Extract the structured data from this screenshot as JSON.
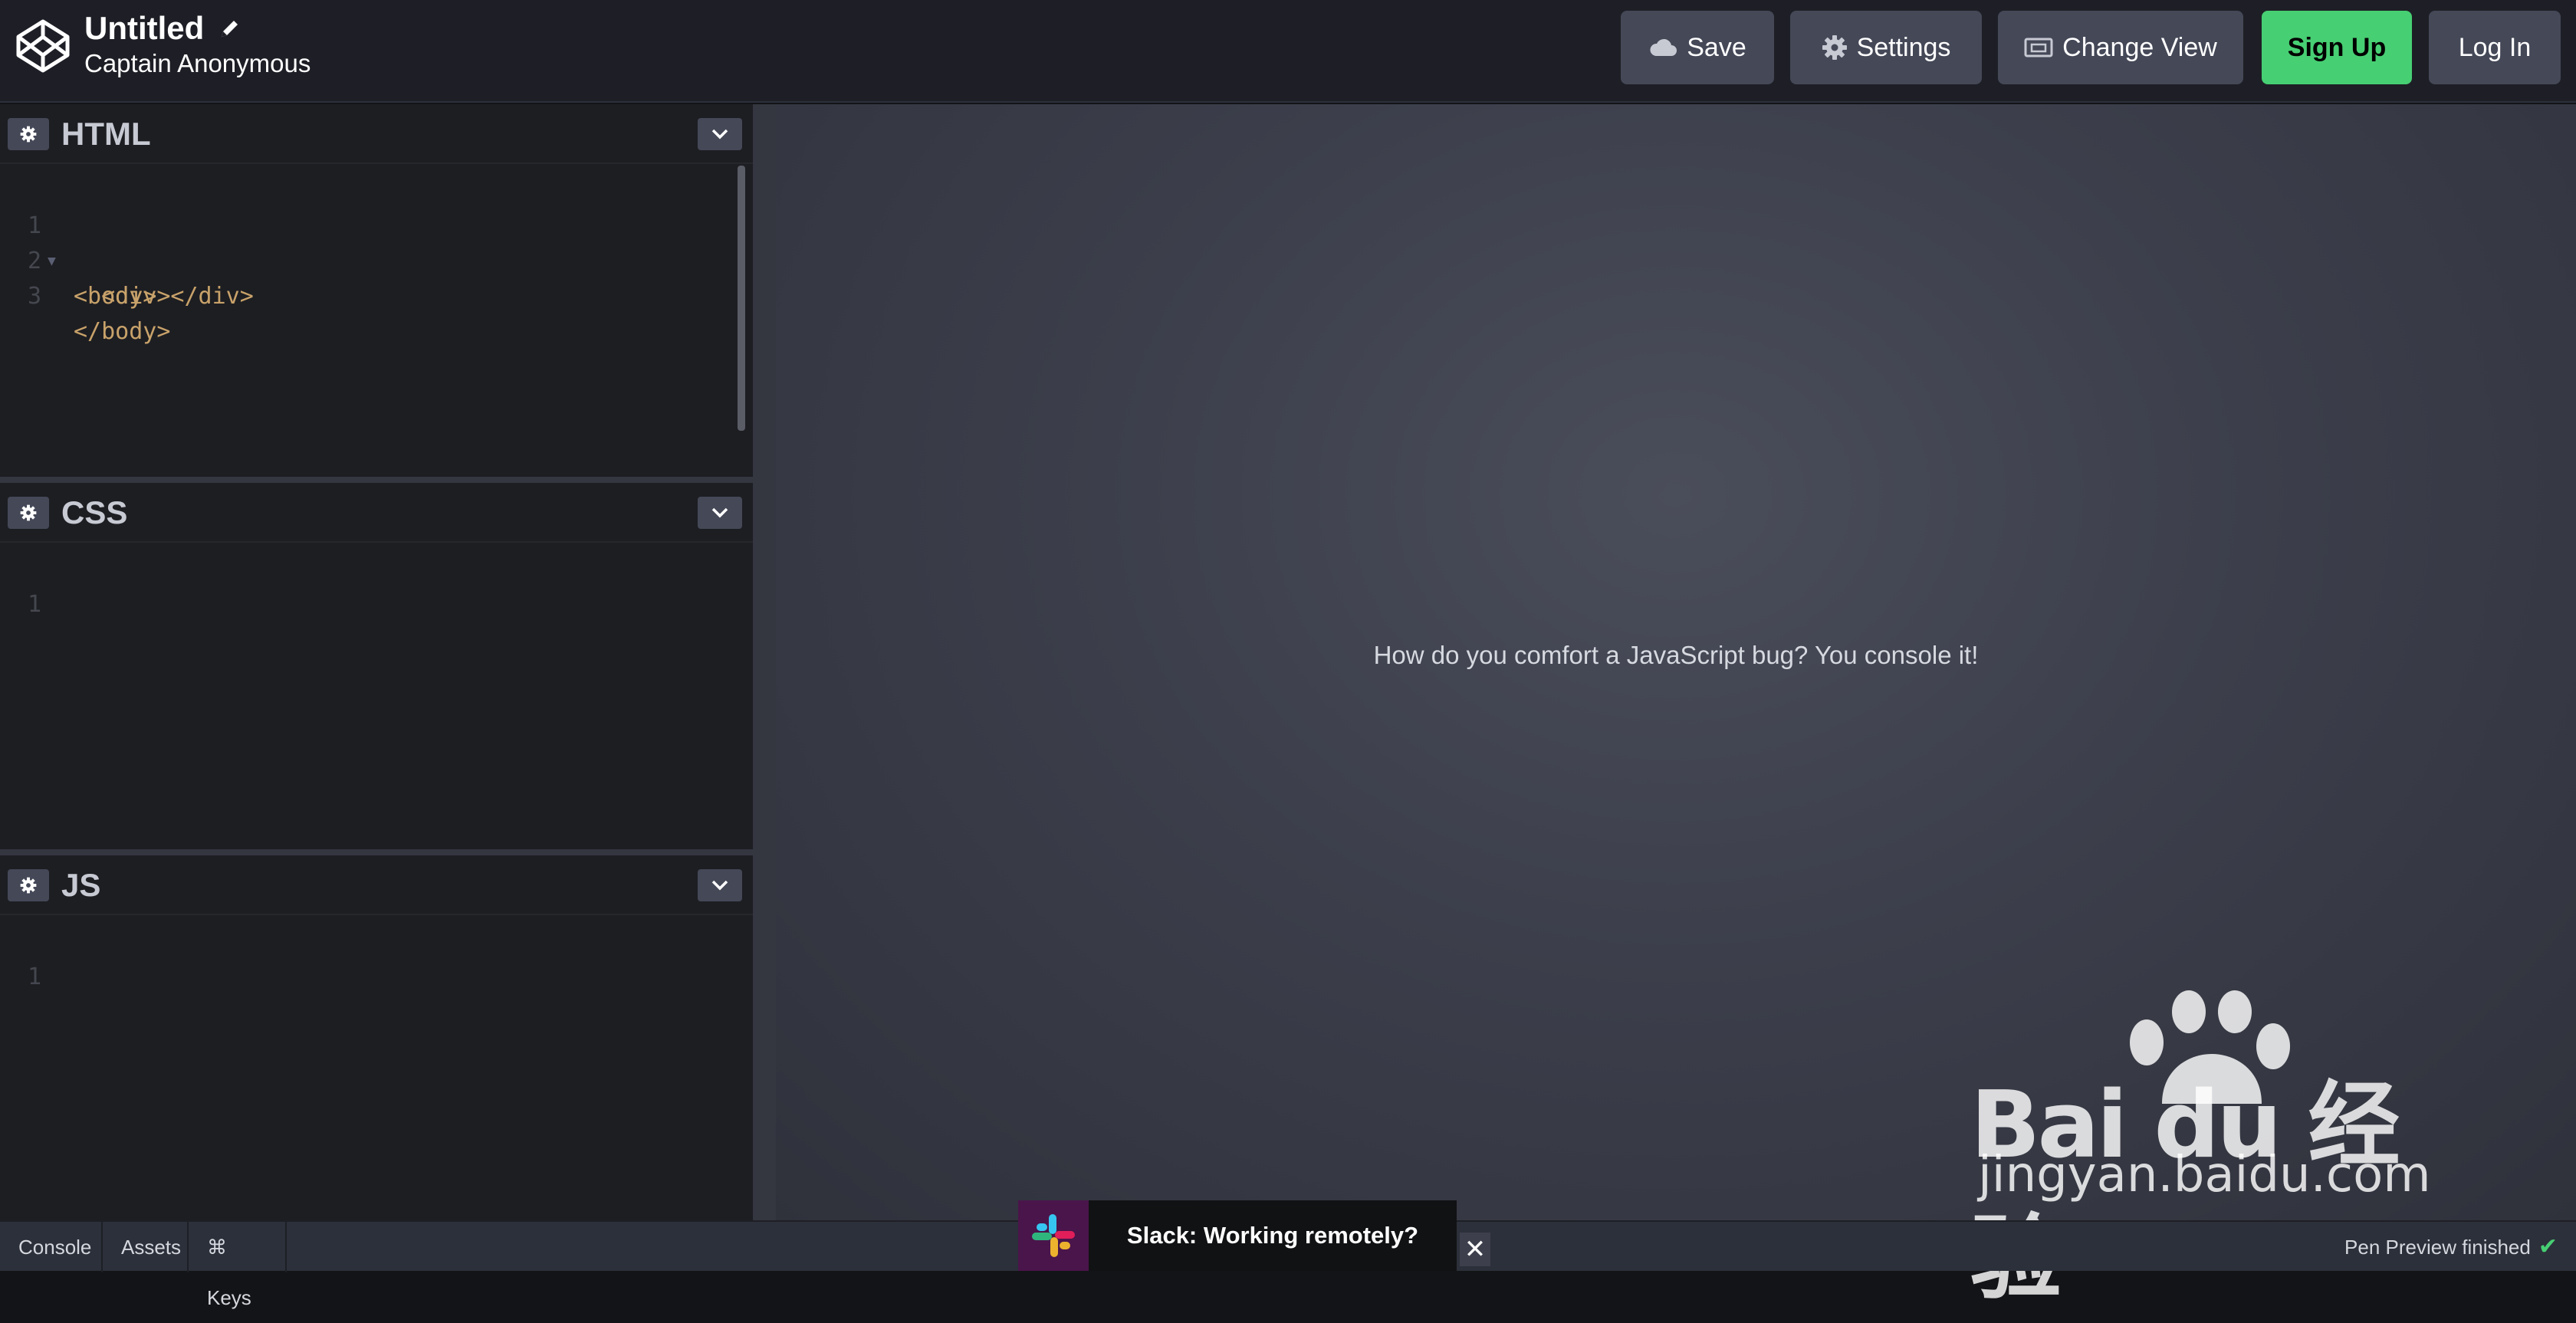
{
  "header": {
    "title": "Untitled",
    "author": "Captain Anonymous",
    "buttons": {
      "save": "Save",
      "settings": "Settings",
      "change_view": "Change View",
      "sign_up": "Sign Up",
      "log_in": "Log In"
    },
    "accent": "#47cf73"
  },
  "editors": {
    "html": {
      "name": "HTML",
      "lines": [
        {
          "num": "1",
          "code": "<body>"
        },
        {
          "num": "2",
          "code": "  <div></div>"
        },
        {
          "num": "3",
          "code": "</body>"
        }
      ]
    },
    "css": {
      "name": "CSS",
      "lines": [
        {
          "num": "1",
          "code": ""
        }
      ]
    },
    "js": {
      "name": "JS",
      "lines": [
        {
          "num": "1",
          "code": ""
        }
      ]
    }
  },
  "preview": {
    "text": "How do you comfort a JavaScript bug? You console it!"
  },
  "footer": {
    "tabs": [
      "Console",
      "Assets",
      "⌘ Keys"
    ],
    "status": "Pen Preview finished"
  },
  "ad": {
    "text": "Slack: Working remotely?",
    "close": "✕"
  },
  "watermark": {
    "brand": "Bai du 经验",
    "url": "jingyan.baidu.com"
  }
}
